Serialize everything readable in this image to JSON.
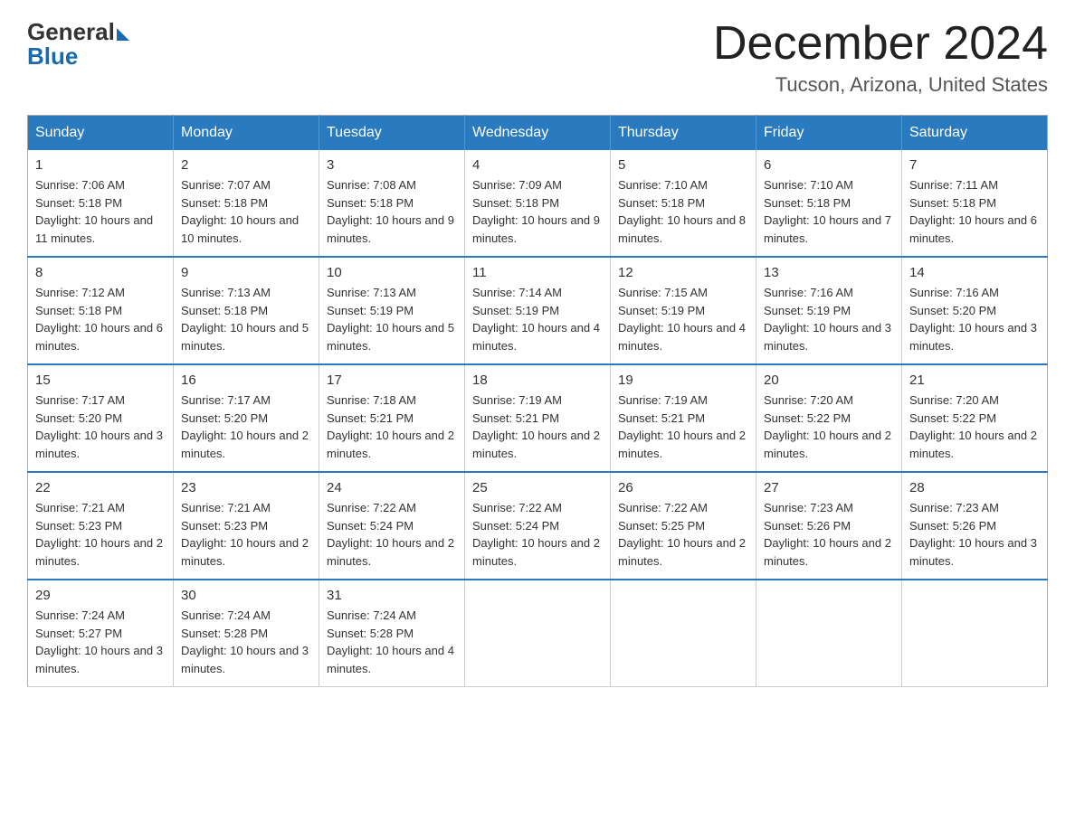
{
  "logo": {
    "general": "General",
    "blue": "Blue"
  },
  "title": "December 2024",
  "location": "Tucson, Arizona, United States",
  "days_of_week": [
    "Sunday",
    "Monday",
    "Tuesday",
    "Wednesday",
    "Thursday",
    "Friday",
    "Saturday"
  ],
  "weeks": [
    [
      {
        "day": "1",
        "sunrise": "7:06 AM",
        "sunset": "5:18 PM",
        "daylight": "10 hours and 11 minutes."
      },
      {
        "day": "2",
        "sunrise": "7:07 AM",
        "sunset": "5:18 PM",
        "daylight": "10 hours and 10 minutes."
      },
      {
        "day": "3",
        "sunrise": "7:08 AM",
        "sunset": "5:18 PM",
        "daylight": "10 hours and 9 minutes."
      },
      {
        "day": "4",
        "sunrise": "7:09 AM",
        "sunset": "5:18 PM",
        "daylight": "10 hours and 9 minutes."
      },
      {
        "day": "5",
        "sunrise": "7:10 AM",
        "sunset": "5:18 PM",
        "daylight": "10 hours and 8 minutes."
      },
      {
        "day": "6",
        "sunrise": "7:10 AM",
        "sunset": "5:18 PM",
        "daylight": "10 hours and 7 minutes."
      },
      {
        "day": "7",
        "sunrise": "7:11 AM",
        "sunset": "5:18 PM",
        "daylight": "10 hours and 6 minutes."
      }
    ],
    [
      {
        "day": "8",
        "sunrise": "7:12 AM",
        "sunset": "5:18 PM",
        "daylight": "10 hours and 6 minutes."
      },
      {
        "day": "9",
        "sunrise": "7:13 AM",
        "sunset": "5:18 PM",
        "daylight": "10 hours and 5 minutes."
      },
      {
        "day": "10",
        "sunrise": "7:13 AM",
        "sunset": "5:19 PM",
        "daylight": "10 hours and 5 minutes."
      },
      {
        "day": "11",
        "sunrise": "7:14 AM",
        "sunset": "5:19 PM",
        "daylight": "10 hours and 4 minutes."
      },
      {
        "day": "12",
        "sunrise": "7:15 AM",
        "sunset": "5:19 PM",
        "daylight": "10 hours and 4 minutes."
      },
      {
        "day": "13",
        "sunrise": "7:16 AM",
        "sunset": "5:19 PM",
        "daylight": "10 hours and 3 minutes."
      },
      {
        "day": "14",
        "sunrise": "7:16 AM",
        "sunset": "5:20 PM",
        "daylight": "10 hours and 3 minutes."
      }
    ],
    [
      {
        "day": "15",
        "sunrise": "7:17 AM",
        "sunset": "5:20 PM",
        "daylight": "10 hours and 3 minutes."
      },
      {
        "day": "16",
        "sunrise": "7:17 AM",
        "sunset": "5:20 PM",
        "daylight": "10 hours and 2 minutes."
      },
      {
        "day": "17",
        "sunrise": "7:18 AM",
        "sunset": "5:21 PM",
        "daylight": "10 hours and 2 minutes."
      },
      {
        "day": "18",
        "sunrise": "7:19 AM",
        "sunset": "5:21 PM",
        "daylight": "10 hours and 2 minutes."
      },
      {
        "day": "19",
        "sunrise": "7:19 AM",
        "sunset": "5:21 PM",
        "daylight": "10 hours and 2 minutes."
      },
      {
        "day": "20",
        "sunrise": "7:20 AM",
        "sunset": "5:22 PM",
        "daylight": "10 hours and 2 minutes."
      },
      {
        "day": "21",
        "sunrise": "7:20 AM",
        "sunset": "5:22 PM",
        "daylight": "10 hours and 2 minutes."
      }
    ],
    [
      {
        "day": "22",
        "sunrise": "7:21 AM",
        "sunset": "5:23 PM",
        "daylight": "10 hours and 2 minutes."
      },
      {
        "day": "23",
        "sunrise": "7:21 AM",
        "sunset": "5:23 PM",
        "daylight": "10 hours and 2 minutes."
      },
      {
        "day": "24",
        "sunrise": "7:22 AM",
        "sunset": "5:24 PM",
        "daylight": "10 hours and 2 minutes."
      },
      {
        "day": "25",
        "sunrise": "7:22 AM",
        "sunset": "5:24 PM",
        "daylight": "10 hours and 2 minutes."
      },
      {
        "day": "26",
        "sunrise": "7:22 AM",
        "sunset": "5:25 PM",
        "daylight": "10 hours and 2 minutes."
      },
      {
        "day": "27",
        "sunrise": "7:23 AM",
        "sunset": "5:26 PM",
        "daylight": "10 hours and 2 minutes."
      },
      {
        "day": "28",
        "sunrise": "7:23 AM",
        "sunset": "5:26 PM",
        "daylight": "10 hours and 3 minutes."
      }
    ],
    [
      {
        "day": "29",
        "sunrise": "7:24 AM",
        "sunset": "5:27 PM",
        "daylight": "10 hours and 3 minutes."
      },
      {
        "day": "30",
        "sunrise": "7:24 AM",
        "sunset": "5:28 PM",
        "daylight": "10 hours and 3 minutes."
      },
      {
        "day": "31",
        "sunrise": "7:24 AM",
        "sunset": "5:28 PM",
        "daylight": "10 hours and 4 minutes."
      },
      null,
      null,
      null,
      null
    ]
  ],
  "labels": {
    "sunrise": "Sunrise:",
    "sunset": "Sunset:",
    "daylight": "Daylight:"
  }
}
